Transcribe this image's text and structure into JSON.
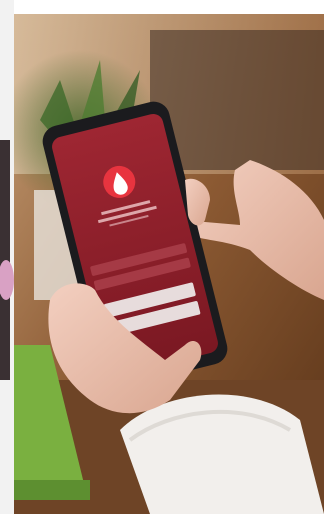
{
  "photo": {
    "subject": "hand-holding-smartphone",
    "app_theme_color": "#8e1f2a",
    "app_icon": "drop-icon",
    "screen_text_legible": false
  }
}
